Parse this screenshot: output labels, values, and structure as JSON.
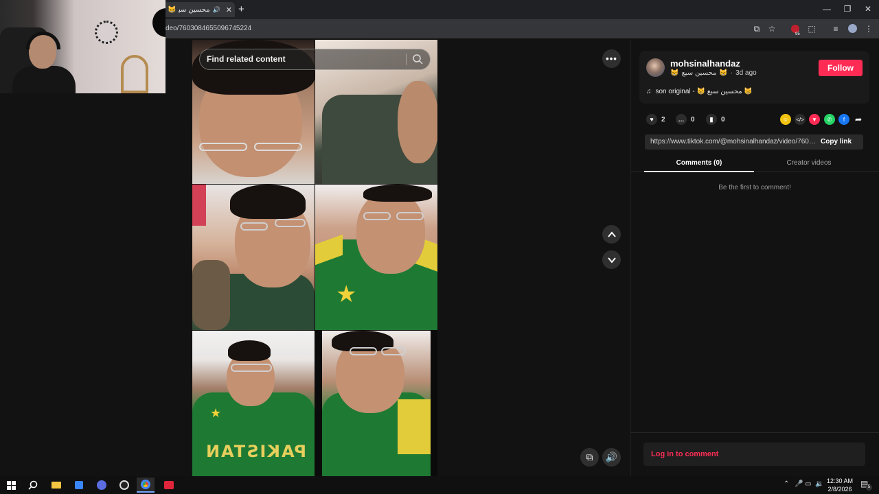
{
  "browser": {
    "tab_title": "محسين سبع",
    "tab_emoji": "😸",
    "url": "deo/7603084655096745224",
    "new_tab": "+",
    "win_minimize": "—",
    "win_restore": "❐",
    "win_close": "✕",
    "extension_badge": "95"
  },
  "video": {
    "search_placeholder": "Find related content",
    "jersey_text": "PAKISTAN"
  },
  "creator": {
    "username": "mohsinalhandaz",
    "nickname": "محسين سبع",
    "nickname_emoji": "😸",
    "time_ago": "3d ago",
    "follow_label": "Follow",
    "music": "son original - 😸 محسين سبع 😸"
  },
  "stats": {
    "likes": "2",
    "comments": "0",
    "saves": "0"
  },
  "share": {
    "link": "https://www.tiktok.com/@mohsinalhandaz/video/7603...",
    "copy_label": "Copy link"
  },
  "tabs": {
    "comments": "Comments (0)",
    "creator_videos": "Creator videos"
  },
  "comments": {
    "empty_text": "Be the first to comment!",
    "login_label": "Log in to comment"
  },
  "taskbar": {
    "time": "12:30 AM",
    "date": "2/8/2026",
    "notification_count": "5"
  },
  "colors": {
    "accent": "#fe2c55",
    "background": "#121212"
  }
}
